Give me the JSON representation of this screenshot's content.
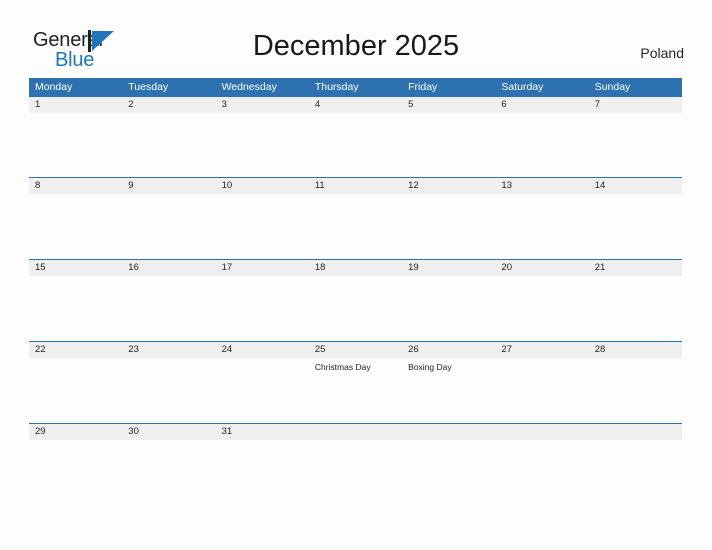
{
  "header": {
    "logo": {
      "line1": "General",
      "line2": "Blue",
      "mark": "triangle-flag"
    },
    "title": "December 2025",
    "country": "Poland"
  },
  "calendar": {
    "weekdays": [
      "Monday",
      "Tuesday",
      "Wednesday",
      "Thursday",
      "Friday",
      "Saturday",
      "Sunday"
    ],
    "colors": {
      "header_blue": "#2e71b0",
      "row_stripe": "#efefef",
      "page_background": "#fdfdfd",
      "text": "#231f20",
      "logo_blue": "#1f76bd"
    },
    "weeks": [
      {
        "days": [
          {
            "number": "1",
            "event": ""
          },
          {
            "number": "2",
            "event": ""
          },
          {
            "number": "3",
            "event": ""
          },
          {
            "number": "4",
            "event": ""
          },
          {
            "number": "5",
            "event": ""
          },
          {
            "number": "6",
            "event": ""
          },
          {
            "number": "7",
            "event": ""
          }
        ]
      },
      {
        "days": [
          {
            "number": "8",
            "event": ""
          },
          {
            "number": "9",
            "event": ""
          },
          {
            "number": "10",
            "event": ""
          },
          {
            "number": "11",
            "event": ""
          },
          {
            "number": "12",
            "event": ""
          },
          {
            "number": "13",
            "event": ""
          },
          {
            "number": "14",
            "event": ""
          }
        ]
      },
      {
        "days": [
          {
            "number": "15",
            "event": ""
          },
          {
            "number": "16",
            "event": ""
          },
          {
            "number": "17",
            "event": ""
          },
          {
            "number": "18",
            "event": ""
          },
          {
            "number": "19",
            "event": ""
          },
          {
            "number": "20",
            "event": ""
          },
          {
            "number": "21",
            "event": ""
          }
        ]
      },
      {
        "days": [
          {
            "number": "22",
            "event": ""
          },
          {
            "number": "23",
            "event": ""
          },
          {
            "number": "24",
            "event": ""
          },
          {
            "number": "25",
            "event": "Christmas Day"
          },
          {
            "number": "26",
            "event": "Boxing Day"
          },
          {
            "number": "27",
            "event": ""
          },
          {
            "number": "28",
            "event": ""
          }
        ]
      },
      {
        "days": [
          {
            "number": "29",
            "event": ""
          },
          {
            "number": "30",
            "event": ""
          },
          {
            "number": "31",
            "event": ""
          },
          {
            "number": "",
            "event": ""
          },
          {
            "number": "",
            "event": ""
          },
          {
            "number": "",
            "event": ""
          },
          {
            "number": "",
            "event": ""
          }
        ]
      }
    ]
  }
}
